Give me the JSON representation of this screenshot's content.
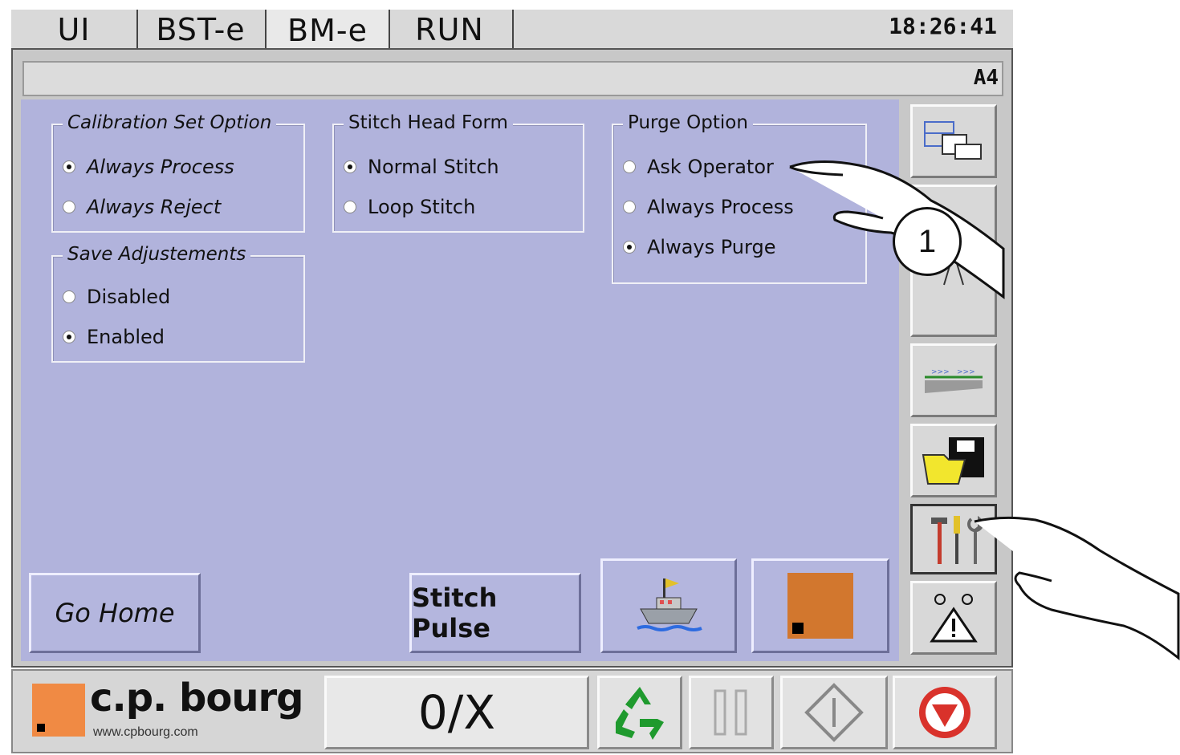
{
  "tabs": [
    {
      "label": "UI",
      "active": false
    },
    {
      "label": "BST-e",
      "active": false
    },
    {
      "label": "BM-e",
      "active": true
    },
    {
      "label": "RUN",
      "active": false
    }
  ],
  "clock": "18:26:41",
  "screen_id": "A4",
  "groups": {
    "calibration": {
      "title": "Calibration Set Option",
      "options": [
        {
          "label": "Always Process",
          "selected": true
        },
        {
          "label": "Always Reject",
          "selected": false
        }
      ]
    },
    "stitch_head": {
      "title": "Stitch Head Form",
      "options": [
        {
          "label": "Normal Stitch",
          "selected": true
        },
        {
          "label": "Loop Stitch",
          "selected": false
        }
      ]
    },
    "purge": {
      "title": "Purge Option",
      "options": [
        {
          "label": "Ask Operator",
          "selected": false
        },
        {
          "label": "Always Process",
          "selected": false
        },
        {
          "label": "Always Purge",
          "selected": true
        }
      ]
    },
    "save_adjustments": {
      "title": "Save Adjustements",
      "options": [
        {
          "label": "Disabled",
          "selected": false
        },
        {
          "label": "Enabled",
          "selected": true
        }
      ]
    }
  },
  "buttons": {
    "go_home": "Go Home",
    "stitch_pulse": "Stitch Pulse"
  },
  "toolbar_icons": [
    "layout-icon",
    "measure-icon",
    "conveyor-icon",
    "folder-save-icon",
    "tools-icon",
    "warning-icon"
  ],
  "bottom": {
    "logo_text": "c.p. bourg",
    "logo_url": "www.cpbourg.com",
    "counter": "0/X"
  },
  "callout": "1",
  "colors": {
    "panel": "#b1b3dc",
    "stop": "#d9322b",
    "recycle": "#1f9a2e",
    "accent_orange": "#d2772e"
  }
}
